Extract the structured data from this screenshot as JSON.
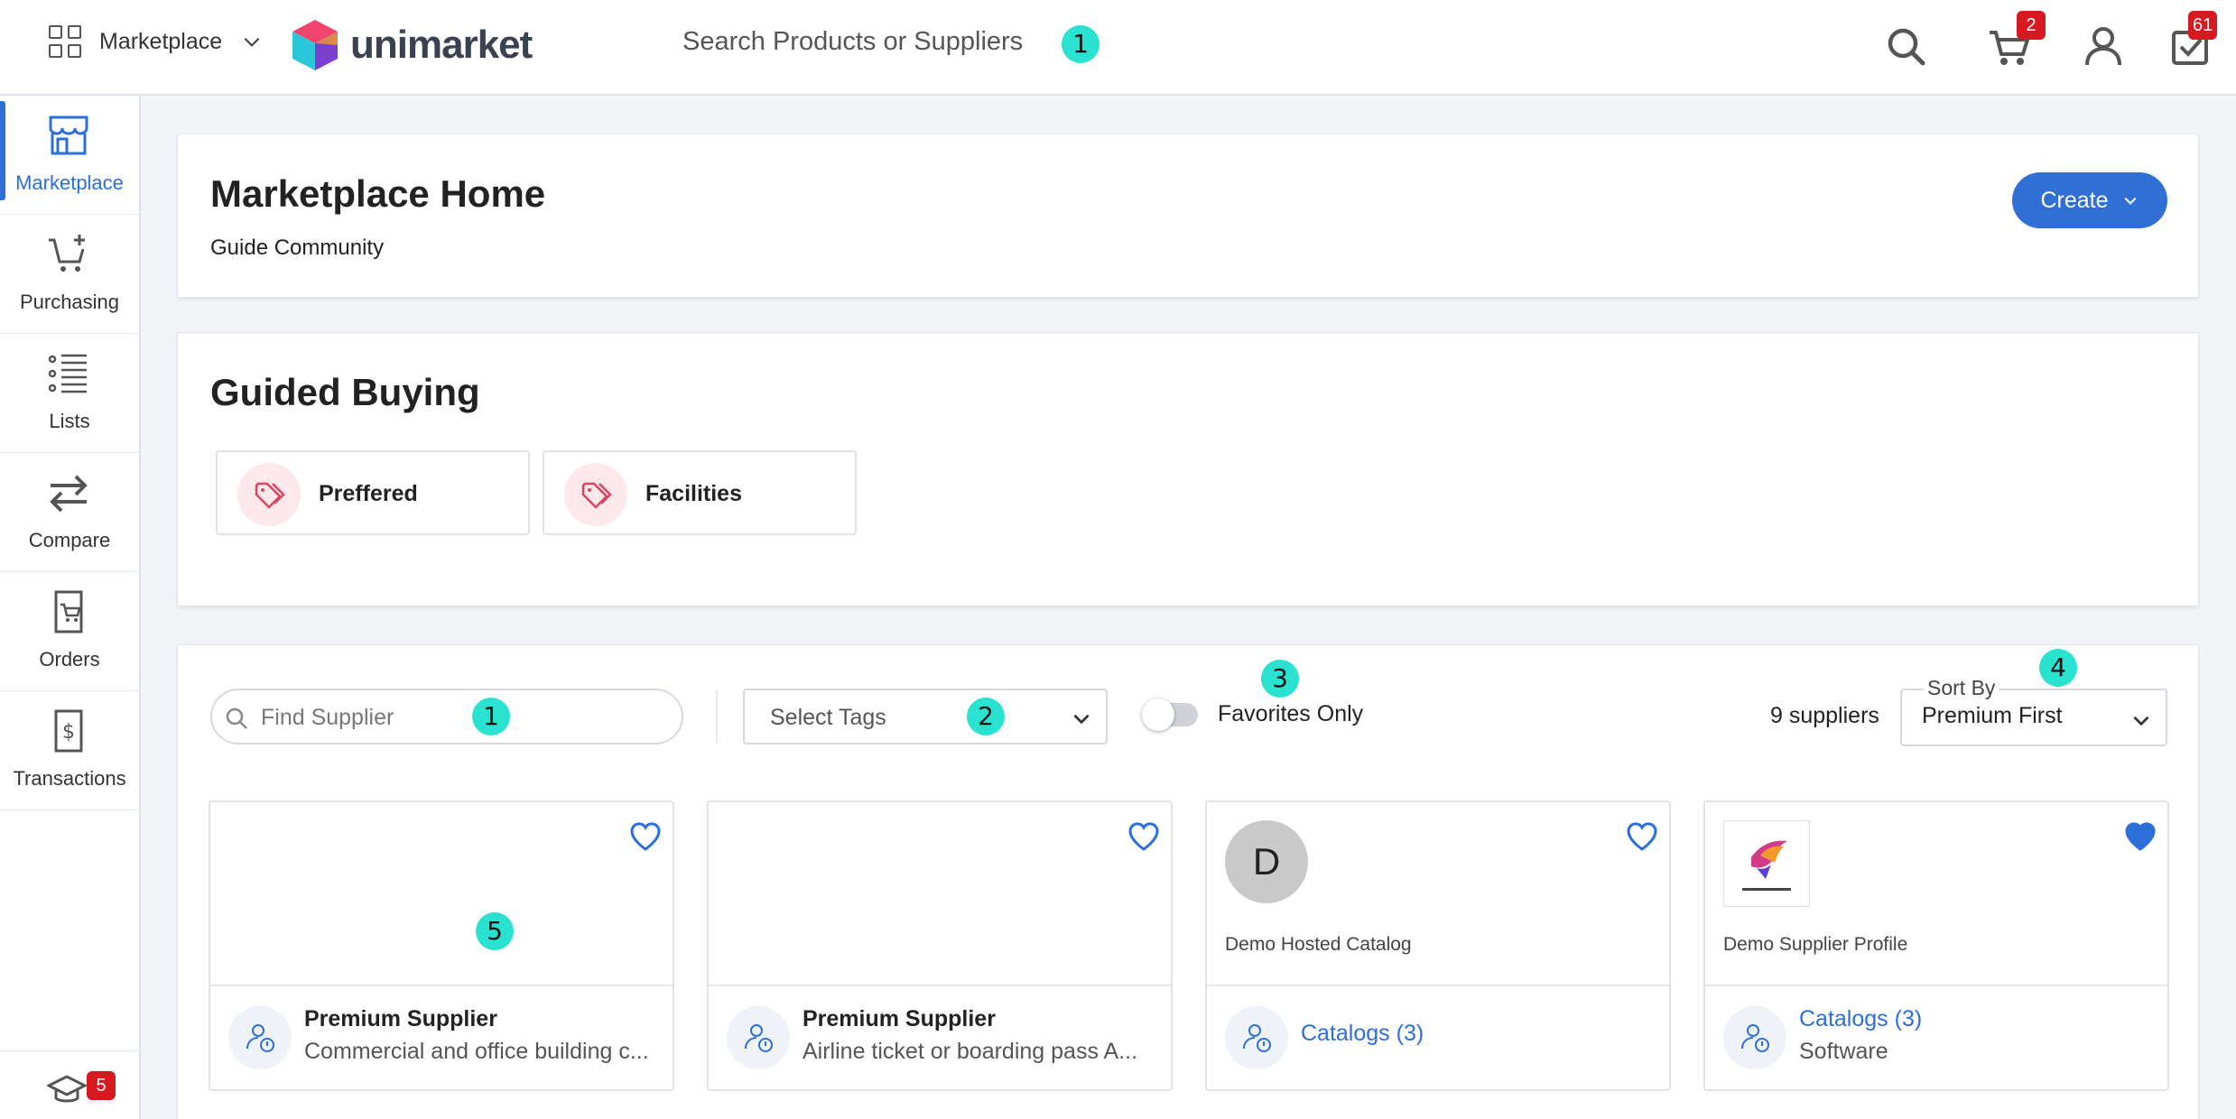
{
  "header": {
    "app_switcher_label": "Marketplace",
    "logo_text": "unimarket",
    "search_placeholder": "Search Products or Suppliers",
    "cart_badge": "2",
    "tasks_badge": "61"
  },
  "markers": {
    "m1": "1",
    "m2": "2",
    "m3": "3",
    "m4": "4",
    "m5": "5"
  },
  "sidebar": {
    "items": [
      {
        "label": "Marketplace",
        "icon": "storefront-icon",
        "active": true
      },
      {
        "label": "Purchasing",
        "icon": "cart-plus-icon"
      },
      {
        "label": "Lists",
        "icon": "list-icon"
      },
      {
        "label": "Compare",
        "icon": "compare-arrows-icon"
      },
      {
        "label": "Orders",
        "icon": "order-cart-doc-icon"
      },
      {
        "label": "Transactions",
        "icon": "dollar-doc-icon"
      }
    ],
    "learning_badge": "5"
  },
  "home": {
    "title": "Marketplace Home",
    "subtitle": "Guide Community",
    "create_label": "Create"
  },
  "guided_buying": {
    "title": "Guided Buying",
    "cards": [
      {
        "label": "Preffered"
      },
      {
        "label": "Facilities"
      }
    ]
  },
  "suppliers": {
    "find_placeholder": "Find Supplier",
    "tags_placeholder": "Select Tags",
    "favorites_label": "Favorites Only",
    "count_label": "9 suppliers",
    "sort_legend": "Sort By",
    "sort_value": "Premium First",
    "cards": [
      {
        "line1": "Premium Supplier",
        "line2": "Commercial and office building c...",
        "favorite": false
      },
      {
        "line1": "Premium Supplier",
        "line2": "Airline ticket or boarding pass A...",
        "favorite": false
      },
      {
        "name": "Demo Hosted Catalog",
        "avatar_letter": "D",
        "line1": "Catalogs (3)",
        "favorite": false
      },
      {
        "name": "Demo Supplier Profile",
        "line1": "Catalogs (3)",
        "line2": "Software",
        "favorite": true
      }
    ]
  },
  "colors": {
    "accent": "#2d6fd8",
    "badge": "#d7191f",
    "marker": "#29e2cf",
    "tag_pink": "#d9465f"
  }
}
